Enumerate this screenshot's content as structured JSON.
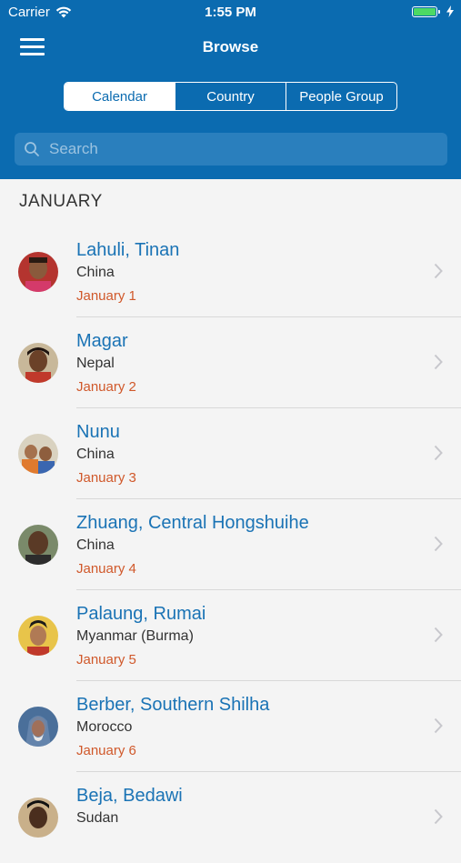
{
  "status_bar": {
    "carrier": "Carrier",
    "time": "1:55 PM"
  },
  "nav": {
    "title": "Browse"
  },
  "segments": [
    {
      "label": "Calendar",
      "active": true
    },
    {
      "label": "Country",
      "active": false
    },
    {
      "label": "People Group",
      "active": false
    }
  ],
  "search": {
    "placeholder": "Search"
  },
  "section": {
    "title": "JANUARY"
  },
  "items": [
    {
      "name": "Lahuli, Tinan",
      "country": "China",
      "date": "January 1"
    },
    {
      "name": "Magar",
      "country": "Nepal",
      "date": "January 2"
    },
    {
      "name": "Nunu",
      "country": "China",
      "date": "January 3"
    },
    {
      "name": "Zhuang, Central Hongshuihe",
      "country": "China",
      "date": "January 4"
    },
    {
      "name": "Palaung, Rumai",
      "country": "Myanmar (Burma)",
      "date": "January 5"
    },
    {
      "name": "Berber, Southern Shilha",
      "country": "Morocco",
      "date": "January 6"
    },
    {
      "name": "Beja, Bedawi",
      "country": "Sudan",
      "date": ""
    }
  ],
  "colors": {
    "accent": "#0b6bb0",
    "title_link": "#1a73b5",
    "date": "#d0582a",
    "battery": "#4cd964"
  }
}
